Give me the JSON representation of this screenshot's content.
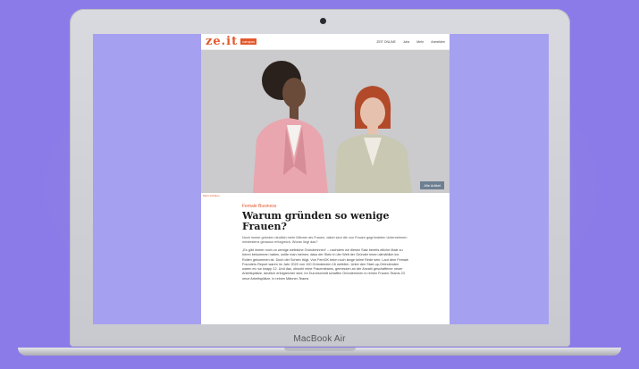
{
  "device": {
    "brand_label": "MacBook Air"
  },
  "nav": {
    "logo": "ze.it",
    "badge": "campus",
    "links": [
      "ZEIT ONLINE",
      "Jobs",
      "Mehr",
      "Anmelden"
    ]
  },
  "hero": {
    "button_label": "Alle Artikel",
    "caption": "Mehr erfahren"
  },
  "article": {
    "kicker": "Female Business",
    "headline": "Warum gründen so wenige Frauen?",
    "lead": "Noch immer gründen deutlich mehr Männer als Frauen, dabei sind die von Frauen gegründeten Unternehmen mindestens genauso erfolgreich. Woran liegt das?",
    "body": "„Es gibt immer noch zu wenige weibliche Gründerinnen“ – nachdem wir diesen Satz bereits etliche Male zu hören bekommen haben, sollte man meinen, dass der Stein in der Welt der Gründer innen allmählich ins Rollen gekommen ist. Doch der Schein trügt. Von FemGK beim noch lange keine Rede sein. Laut dem Female Founders Report waren im Jahr 2020 von 100 Gründenden 16 weiblich. Unter den Start-up-Gründenden waren es nur knapp 12. Und das, obwohl reine Frauenteams, gemessen an der Anzahl geschaffener neuer Arbeitsplätze, deutlich erfolgreicher sind. Im Durchschnitt schaffen Gründerinnen in reinen Frauen-Teams 23 neue Arbeitsplätze, in reinen Männer-Teams"
  }
}
